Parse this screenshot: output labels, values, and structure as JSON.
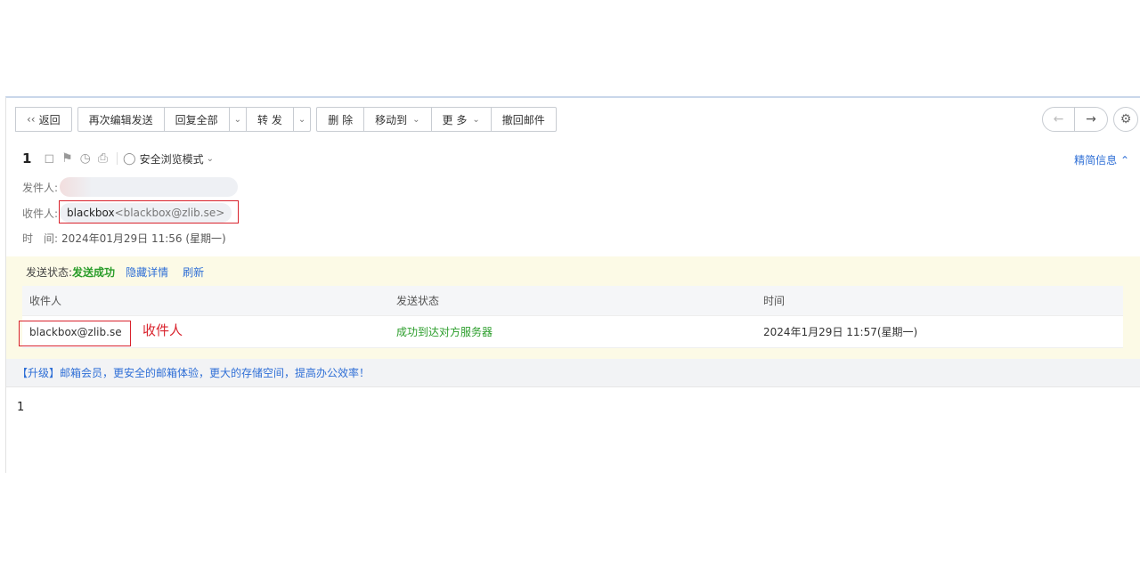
{
  "toolbar": {
    "back": "返回",
    "reedit": "再次编辑发送",
    "reply_all": "回复全部",
    "forward": "转 发",
    "delete": "删 除",
    "move_to": "移动到",
    "more": "更 多",
    "recall": "撤回邮件"
  },
  "header": {
    "subject": "1",
    "safe_mode": "安全浏览模式",
    "brief_info": "精简信息",
    "sender_label": "发件人:",
    "recipient_label": "收件人:",
    "recipient_name": "blackbox",
    "recipient_email": "<blackbox@zlib.se>",
    "time_label": "时　间:",
    "time_value": "2024年01月29日 11:56 (星期一)"
  },
  "send_status": {
    "label": "发送状态:",
    "value": "发送成功",
    "hide_details": "隐藏详情",
    "refresh": "刷新",
    "columns": [
      "收件人",
      "发送状态",
      "时间"
    ],
    "rows": [
      {
        "recipient": "blackbox@zlib.se",
        "status": "成功到达对方服务器",
        "time": "2024年1月29日 11:57(星期一)"
      }
    ]
  },
  "annotation": "收件人",
  "upgrade_banner": "【升级】邮箱会员，更安全的邮箱体验，更大的存储空间，提高办公效率！",
  "body": "1",
  "colors": {
    "accent": "#2f6fd6",
    "success": "#2a9d2a",
    "highlight": "#d9232d",
    "status_bg": "#fcfae6"
  }
}
